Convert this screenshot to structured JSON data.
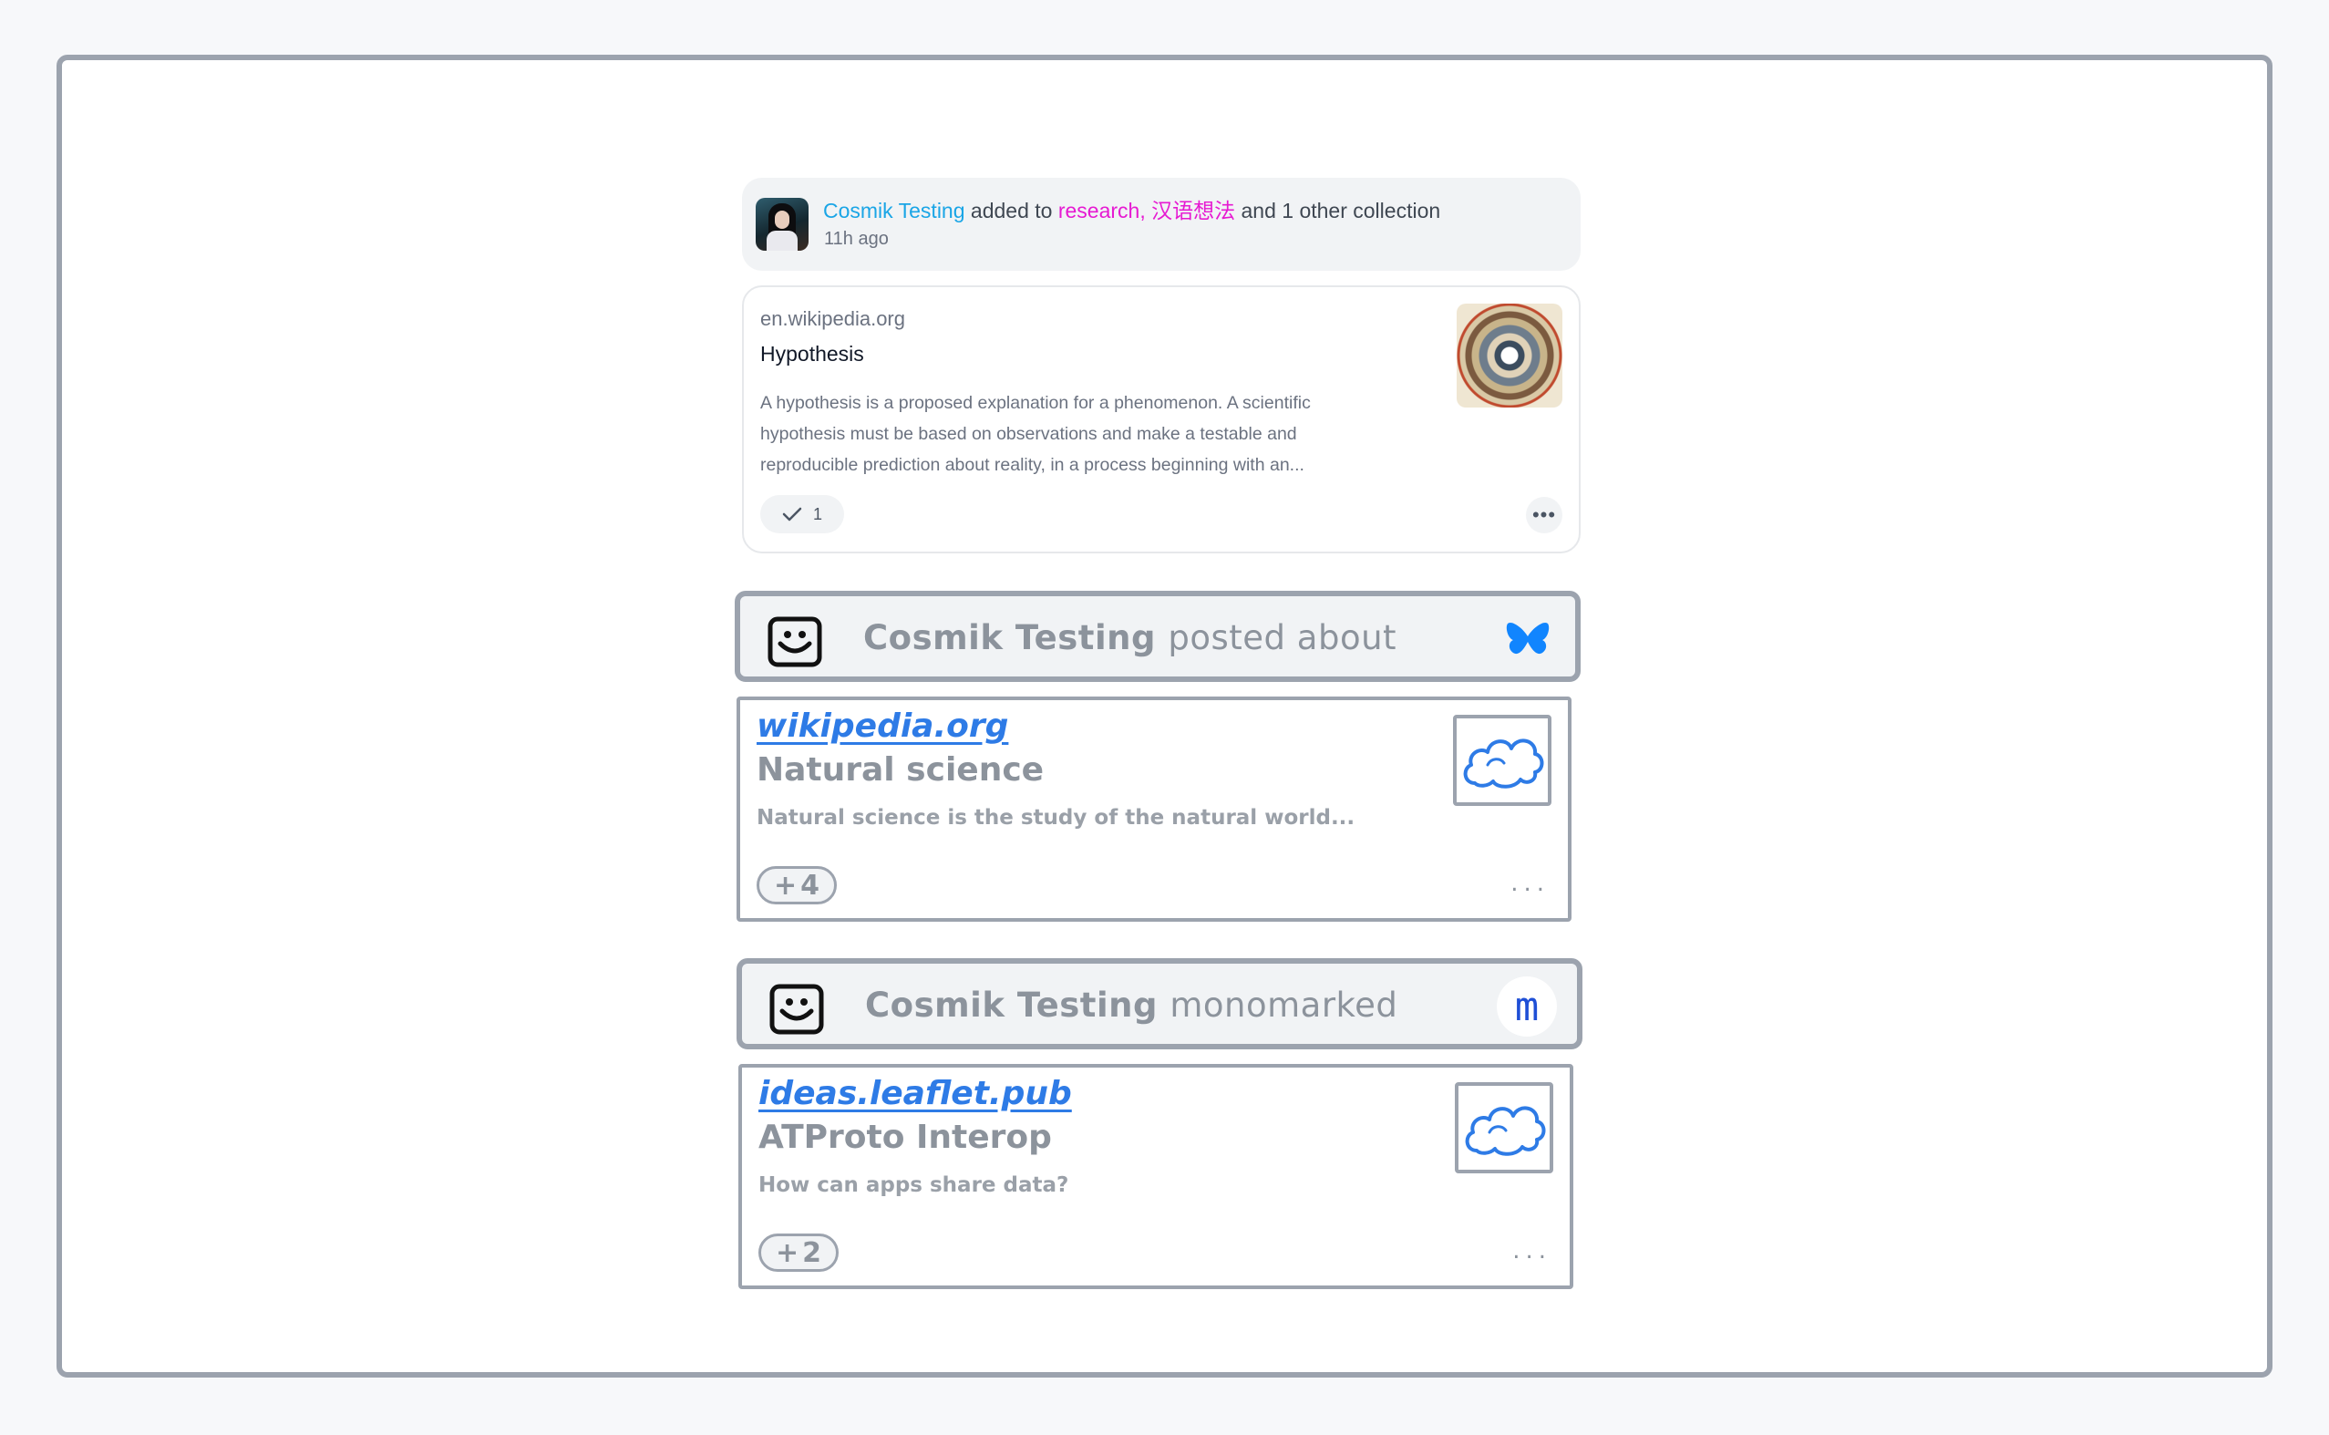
{
  "activity": {
    "user": "Cosmik Testing",
    "verb": "added to",
    "collection_1": "research",
    "separator": ",",
    "collection_2": "汉语想法",
    "suffix": "and 1 other collection",
    "time": "11h ago"
  },
  "card1": {
    "domain": "en.wikipedia.org",
    "title": "Hypothesis",
    "description": "A hypothesis is a proposed explanation for a phenomenon. A scientific hypothesis must be based on observations and make a testable and reproducible prediction about reality, in a process beginning with an...",
    "saved_count": "1",
    "more_label": "•••"
  },
  "post1": {
    "user": "Cosmik Testing",
    "verb": "posted about",
    "platform_icon": "bluesky-butterfly-icon",
    "domain": "wikipedia.org",
    "title": "Natural science",
    "description": "Natural science is the study of the natural world...",
    "count": "4",
    "more_label": "..."
  },
  "post2": {
    "user": "Cosmik Testing",
    "verb": "monomarked",
    "platform_icon": "m",
    "domain": "ideas.leaflet.pub",
    "title": "ATProto Interop",
    "description": "How can apps share data?",
    "count": "2",
    "more_label": "..."
  },
  "colors": {
    "user_link": "#1aa5e6",
    "collection_link": "#e61ad2",
    "sketch_border": "#9ca3ae",
    "sketch_link": "#2e7be6",
    "bluesky": "#1185fe"
  }
}
